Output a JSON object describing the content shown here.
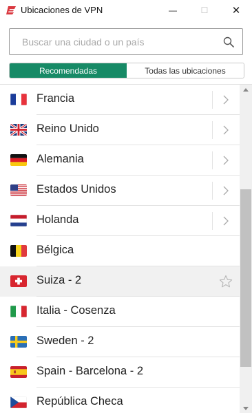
{
  "window": {
    "title": "Ubicaciones de VPN",
    "minimize_label": "—",
    "maximize_label": "☐",
    "close_label": "✕",
    "brand_color": "#da3940"
  },
  "search": {
    "placeholder": "Buscar una ciudad o un país",
    "value": ""
  },
  "tabs": [
    {
      "label": "Recomendadas",
      "active": true
    },
    {
      "label": "Todas las ubicaciones",
      "active": false
    }
  ],
  "accent_color": "#178a66",
  "locations": [
    {
      "label": "Francia",
      "flag": "france-flag-icon",
      "action": "chevron-right-icon"
    },
    {
      "label": "Reino Unido",
      "flag": "uk-flag-icon",
      "action": "chevron-right-icon"
    },
    {
      "label": "Alemania",
      "flag": "germany-flag-icon",
      "action": "chevron-right-icon"
    },
    {
      "label": "Estados Unidos",
      "flag": "usa-flag-icon",
      "action": "chevron-right-icon"
    },
    {
      "label": "Holanda",
      "flag": "netherlands-flag-icon",
      "action": "chevron-right-icon"
    },
    {
      "label": "Bélgica",
      "flag": "belgium-flag-icon",
      "action": ""
    },
    {
      "label": "Suiza - 2",
      "flag": "switzerland-flag-icon",
      "action": "star-icon",
      "selected": true
    },
    {
      "label": "Italia - Cosenza",
      "flag": "italy-flag-icon",
      "action": ""
    },
    {
      "label": "Sweden - 2",
      "flag": "sweden-flag-icon",
      "action": ""
    },
    {
      "label": "Spain - Barcelona - 2",
      "flag": "spain-flag-icon",
      "action": ""
    },
    {
      "label": "República Checa",
      "flag": "czech-flag-icon",
      "action": ""
    }
  ]
}
